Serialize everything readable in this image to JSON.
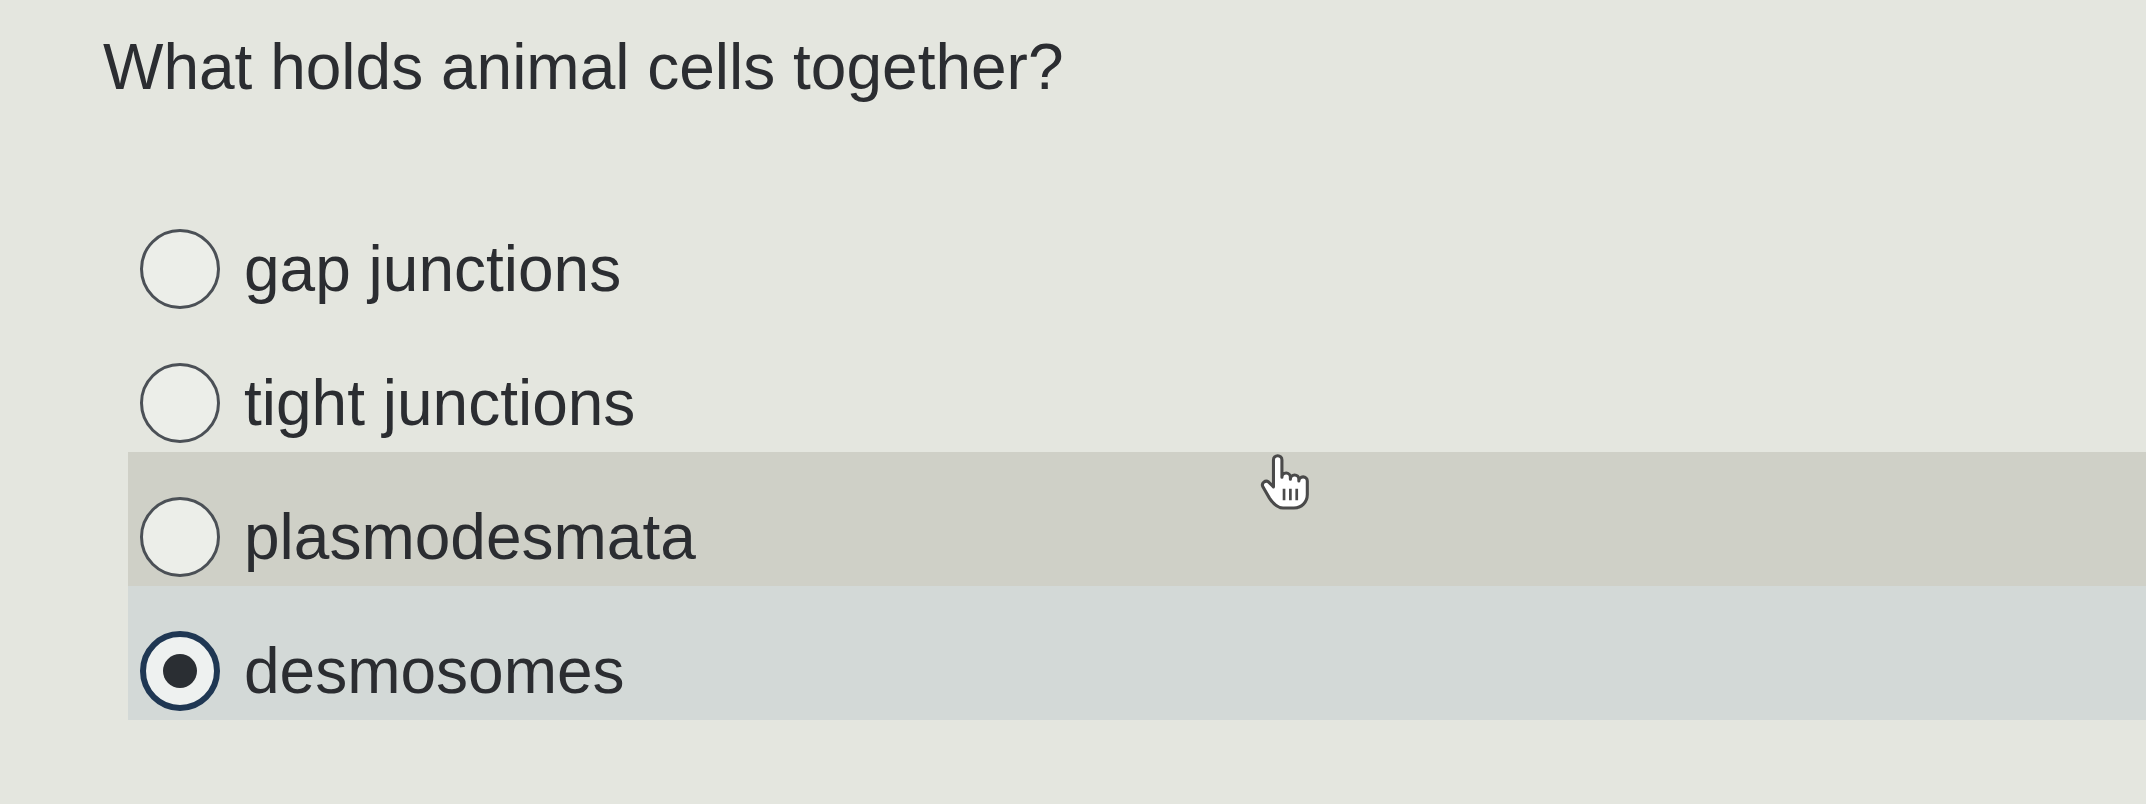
{
  "question": {
    "text": "What holds animal cells together?"
  },
  "options": [
    {
      "label": "gap junctions",
      "selected": false,
      "hovered": false
    },
    {
      "label": "tight junctions",
      "selected": false,
      "hovered": false
    },
    {
      "label": "plasmodesmata",
      "selected": false,
      "hovered": true
    },
    {
      "label": "desmosomes",
      "selected": true,
      "hovered": false
    }
  ]
}
